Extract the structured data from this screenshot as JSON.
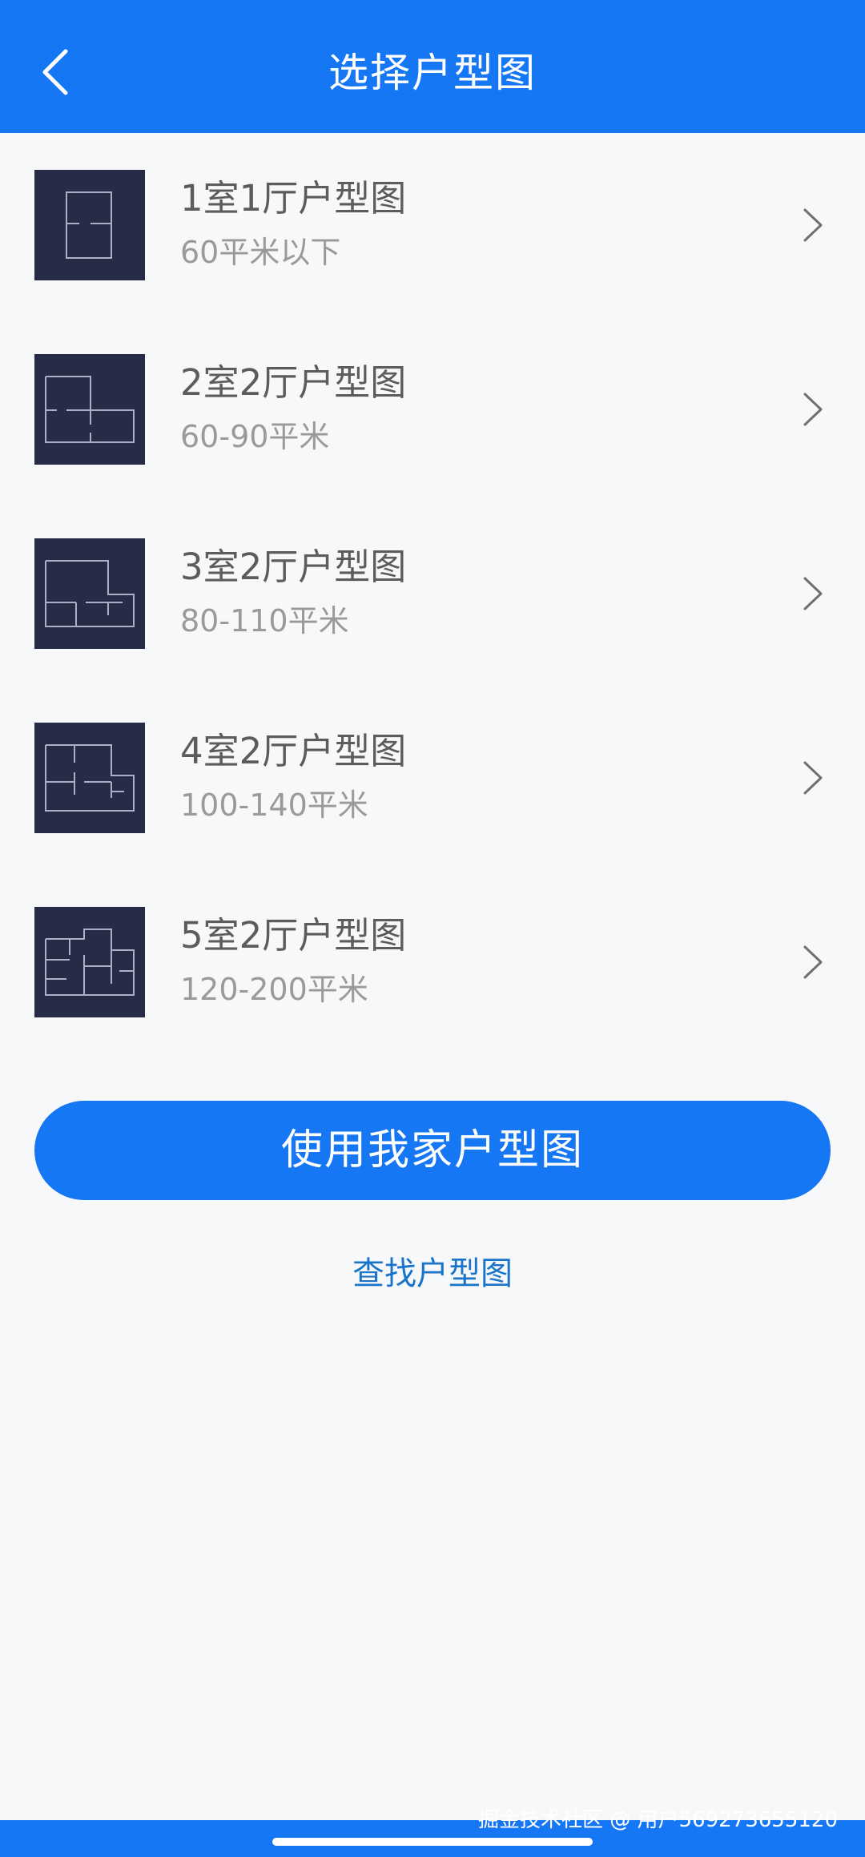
{
  "header": {
    "title": "选择户型图",
    "back_icon": "chevron-left-icon"
  },
  "floor_plans": [
    {
      "title": "1室1厅户型图",
      "area": "60平米以下"
    },
    {
      "title": "2室2厅户型图",
      "area": "60-90平米"
    },
    {
      "title": "3室2厅户型图",
      "area": "80-110平米"
    },
    {
      "title": "4室2厅户型图",
      "area": "100-140平米"
    },
    {
      "title": "5室2厅户型图",
      "area": "120-200平米"
    }
  ],
  "actions": {
    "use_my_plan": "使用我家户型图",
    "find_plan": "查找户型图"
  },
  "watermark": "掘金技术社区 @ 用户569273655120",
  "colors": {
    "primary": "#1677f5",
    "link": "#1a74c9",
    "thumb_bg": "#262b46",
    "page_bg": "#f7f8fa"
  }
}
